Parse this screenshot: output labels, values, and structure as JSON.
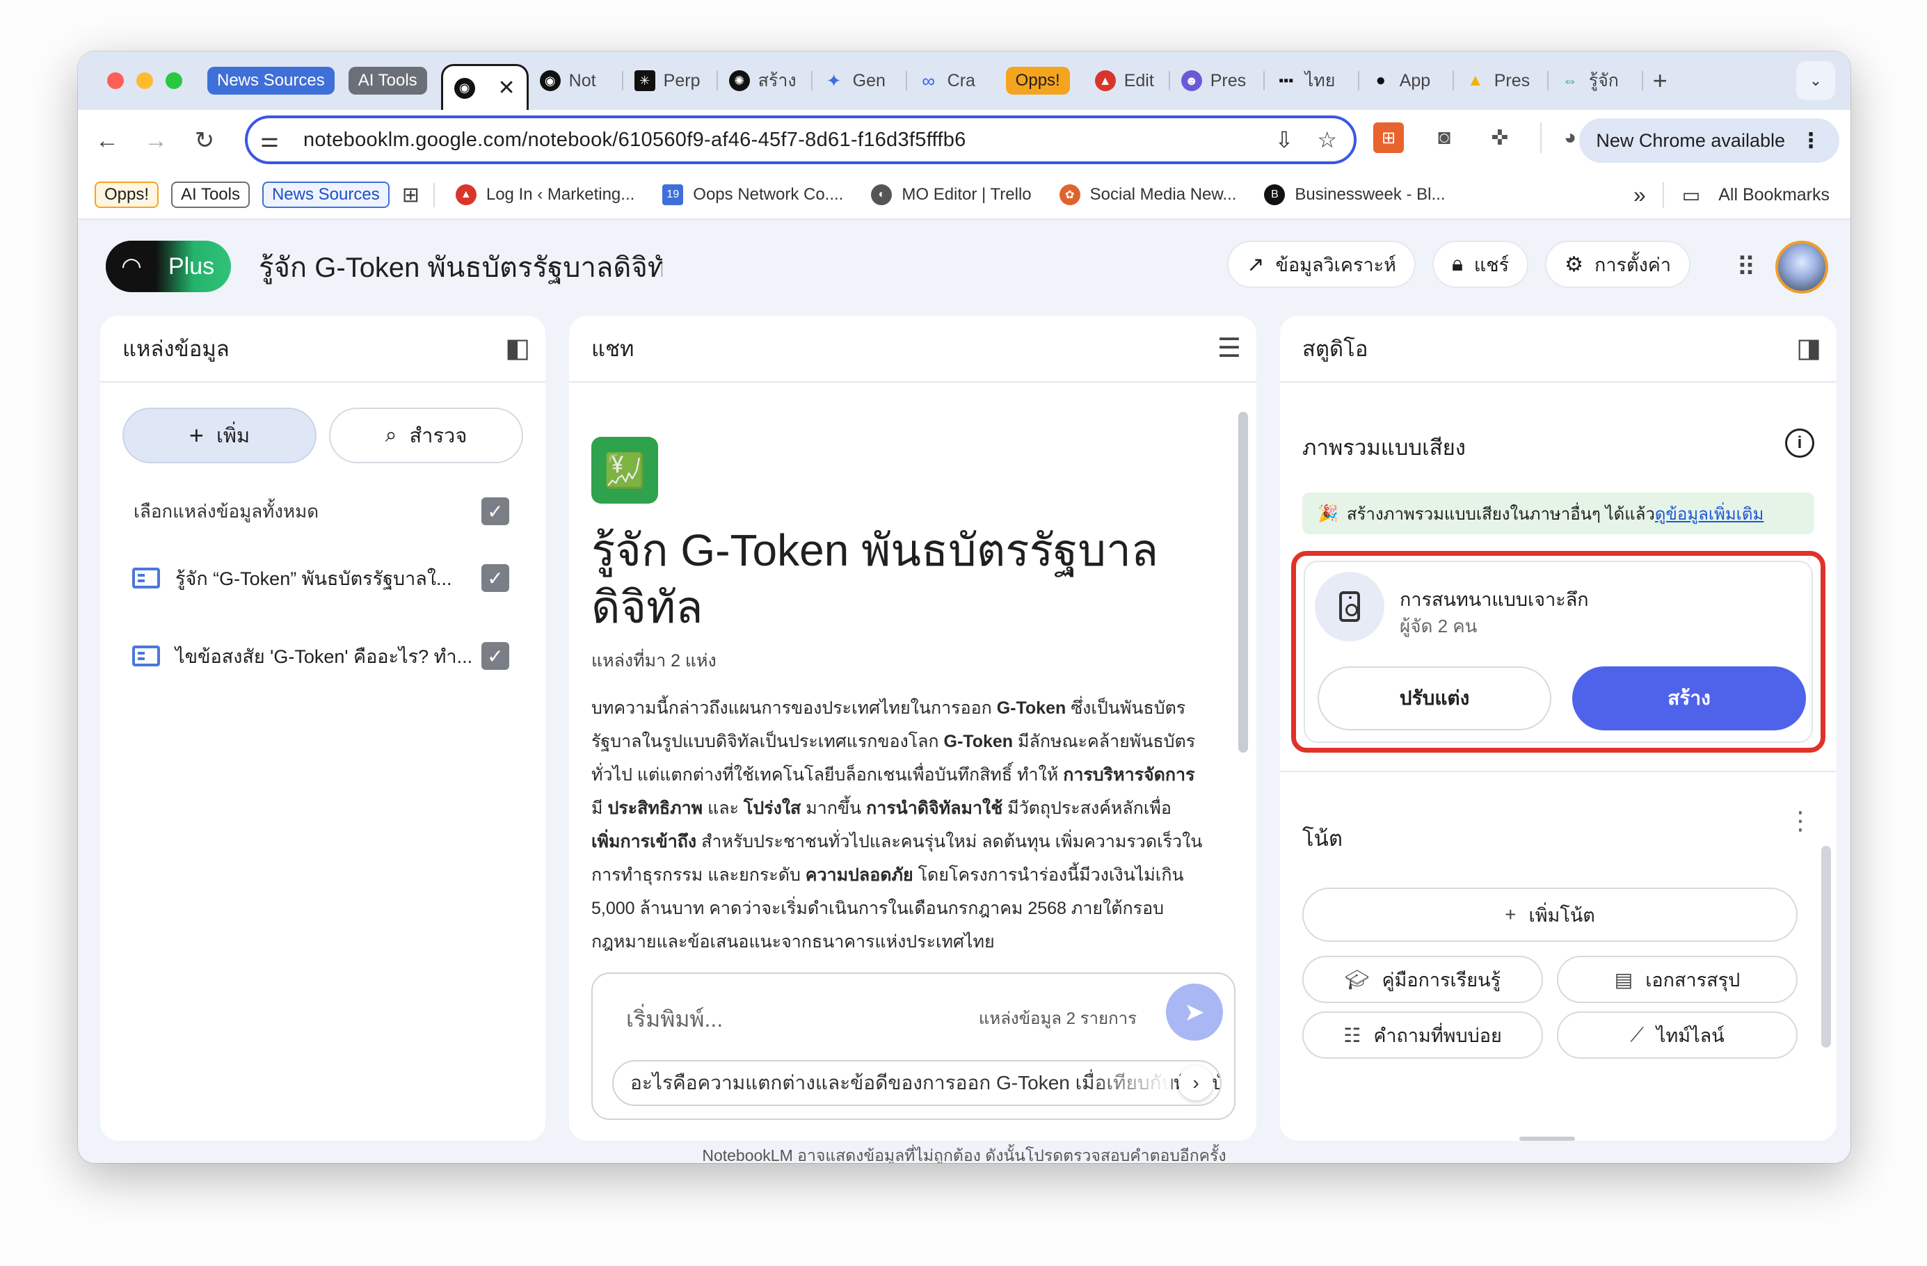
{
  "browser": {
    "tab_groups": [
      {
        "label": "News Sources",
        "color": "#3f6fd9"
      },
      {
        "label": "AI Tools",
        "color": "#6b6f78"
      }
    ],
    "tabs": [
      {
        "label": "Not",
        "icon": "notebooklm-icon"
      },
      {
        "label": "Perp",
        "icon": "perplexity-icon"
      },
      {
        "label": "สร้าง",
        "icon": "openai-icon"
      },
      {
        "label": "Gen",
        "icon": "gemini-icon"
      },
      {
        "label": "Cra",
        "icon": "meta-icon"
      },
      {
        "label": "Edit",
        "icon": "edit-app-icon"
      },
      {
        "label": "Pres",
        "icon": "presentation-app-icon"
      },
      {
        "label": "ไทย",
        "icon": "dots-icon"
      },
      {
        "label": "App",
        "icon": "apple-icon"
      },
      {
        "label": "Pres",
        "icon": "google-drive-icon"
      },
      {
        "label": "รู้จัก",
        "icon": "link-icon"
      }
    ],
    "opps_group_label": "Opps!",
    "opps_group_color": "#f4a41e",
    "url": "notebooklm.google.com/notebook/610560f9-af46-45f7-8d61-f16d3f5fffb6",
    "new_chrome_label": "New Chrome available",
    "bookmarks": {
      "chips": [
        {
          "label": "Opps!",
          "color": "#f4a41e"
        },
        {
          "label": "AI Tools",
          "color": "#6b6f78"
        },
        {
          "label": "News Sources",
          "color": "#3f6fd9"
        }
      ],
      "items": [
        {
          "label": "Log In ‹ Marketing...",
          "icon": "marketing-icon",
          "color": "#d9362b"
        },
        {
          "label": "Oops Network Co....",
          "icon": "calendar-icon",
          "color": "#3f6fd9"
        },
        {
          "label": "MO Editor | Trello",
          "icon": "trello-icon",
          "color": "#555555"
        },
        {
          "label": "Social Media New...",
          "icon": "social-media-icon",
          "color": "#e0632e"
        },
        {
          "label": "Businessweek - Bl...",
          "icon": "businessweek-icon",
          "color": "#111111"
        }
      ],
      "more": "»",
      "all_bookmarks": "All Bookmarks"
    }
  },
  "app": {
    "logo_plus": "Plus",
    "notebook_title": "รู้จัก G-Token พันธบัตรรัฐบาลดิจิทัล",
    "header_buttons": {
      "analytics": "ข้อมูลวิเคราะห์",
      "share": "แชร์",
      "settings": "การตั้งค่า"
    }
  },
  "sources": {
    "title": "แหล่งข้อมูล",
    "add_label": "เพิ่ม",
    "explore_label": "สำรวจ",
    "select_all_label": "เลือกแหล่งข้อมูลทั้งหมด",
    "items": [
      {
        "label": "รู้จัก “G-Token” พันธบัตรรัฐบาลใ..."
      },
      {
        "label": "ไขข้อสงสัย 'G-Token' คืออะไร? ทำ..."
      }
    ]
  },
  "chat": {
    "title": "แชท",
    "emoji": "💹",
    "headline": "รู้จัก G-Token พันธบัตรรัฐบาลดิจิทัล",
    "source_count": "แหล่งที่มา 2 แห่ง",
    "summary_html": "บทความนี้กล่าวถึงแผนการของประเทศไทยในการออก <b>G-Token</b> ซึ่งเป็นพันธบัตรรัฐบาลในรูปแบบดิจิทัลเป็นประเทศแรกของโลก <b>G-Token</b> มีลักษณะคล้ายพันธบัตรทั่วไป แต่แตกต่างที่ใช้เทคโนโลยีบล็อกเชนเพื่อบันทึกสิทธิ์ ทำให้ <b>การบริหารจัดการ</b> มี <b>ประสิทธิภาพ</b> และ <b>โปร่งใส</b> มากขึ้น <b>การนำดิจิทัลมาใช้</b> มีวัตถุประสงค์หลักเพื่อ <b>เพิ่มการเข้าถึง</b> สำหรับประชาชนทั่วไปและคนรุ่นใหม่ ลดต้นทุน เพิ่มความรวดเร็วในการทำธุรกรรม และยกระดับ <b>ความปลอดภัย</b> โดยโครงการนำร่องนี้มีวงเงินไม่เกิน 5,000 ล้านบาท คาดว่าจะเริ่มดำเนินการในเดือนกรกฎาคม 2568 ภายใต้กรอบกฎหมายและข้อเสนอแนะจากธนาคารแห่งประเทศไทย",
    "input_placeholder": "เริ่มพิมพ์...",
    "input_source_count": "แหล่งข้อมูล 2 รายการ",
    "suggestion": "อะไรคือความแตกต่างและข้อดีของการออก G-Token เมื่อเทียบกับพันธบัตร"
  },
  "studio": {
    "title": "สตูดิโอ",
    "audio_overview_title": "ภาพรวมแบบเสียง",
    "banner_text": "สร้างภาพรวมแบบเสียงในภาษาอื่นๆ ได้แล้ว",
    "banner_link": "ดูข้อมูลเพิ่มเติม",
    "card_title": "การสนทนาแบบเจาะลึก",
    "card_subtitle": "ผู้จัด 2 คน",
    "customize_label": "ปรับแต่ง",
    "generate_label": "สร้าง",
    "notes_title": "โน้ต",
    "add_note_label": "เพิ่มโน้ต",
    "study_guide_label": "คู่มือการเรียนรู้",
    "briefing_doc_label": "เอกสารสรุป",
    "faq_label": "คำถามที่พบบ่อย",
    "timeline_label": "ไทม์ไลน์"
  },
  "footer": {
    "disclaimer": "NotebookLM อาจแสดงข้อมูลที่ไม่ถูกต้อง ดังนั้นโปรดตรวจสอบคำตอบอีกครั้ง"
  }
}
